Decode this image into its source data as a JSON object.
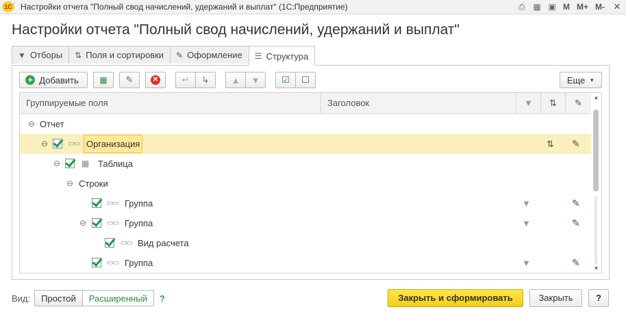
{
  "window": {
    "logo_text": "1С",
    "title": "Настройки отчета \"Полный свод начислений, удержаний и выплат\"  (1С:Предприятие)",
    "memory_buttons": [
      "M",
      "M+",
      "M-"
    ],
    "icons": [
      "print-icon",
      "calculator-icon",
      "calendar-icon"
    ]
  },
  "heading": "Настройки отчета \"Полный свод начислений, удержаний и выплат\"",
  "tabs": [
    {
      "label": "Отборы",
      "icon": "filter-icon",
      "active": false
    },
    {
      "label": "Поля и сортировки",
      "icon": "fields-sort-icon",
      "active": false
    },
    {
      "label": "Оформление",
      "icon": "brush-icon",
      "active": false
    },
    {
      "label": "Структура",
      "icon": "structure-icon",
      "active": true
    }
  ],
  "toolbar": {
    "add_label": "Добавить",
    "more_label": "Еще"
  },
  "grid": {
    "columns": [
      "Группируемые поля",
      "Заголовок"
    ],
    "rows": [
      {
        "label": "Отчет",
        "toggle": "minus",
        "checkbox": false,
        "field_icon": false,
        "filter": false,
        "sort": false,
        "brush": false,
        "selected": false
      },
      {
        "label": "Организация",
        "toggle": "minus",
        "checkbox": true,
        "field_icon": true,
        "filter": false,
        "sort": true,
        "brush": true,
        "selected": true
      },
      {
        "label": "Таблица",
        "toggle": "minus",
        "checkbox": true,
        "field_icon": "table",
        "filter": false,
        "sort": false,
        "brush": false,
        "selected": false
      },
      {
        "label": "Строки",
        "toggle": "minus",
        "checkbox": false,
        "field_icon": false,
        "filter": false,
        "sort": false,
        "brush": false,
        "selected": false
      },
      {
        "label": "Группа",
        "toggle": "",
        "checkbox": true,
        "field_icon": true,
        "filter": true,
        "sort": false,
        "brush": true,
        "selected": false
      },
      {
        "label": "Группа",
        "toggle": "minus",
        "checkbox": true,
        "field_icon": true,
        "filter": true,
        "sort": false,
        "brush": true,
        "selected": false
      },
      {
        "label": "Вид расчета",
        "toggle": "",
        "checkbox": true,
        "field_icon": true,
        "filter": false,
        "sort": false,
        "brush": false,
        "selected": false
      },
      {
        "label": "Группа",
        "toggle": "",
        "checkbox": true,
        "field_icon": true,
        "filter": true,
        "sort": false,
        "brush": true,
        "selected": false
      }
    ]
  },
  "bottom": {
    "view_label": "Вид:",
    "simple_label": "Простой",
    "extended_label": "Расширенный",
    "help": "?",
    "primary_button": "Закрыть и сформировать",
    "close_button": "Закрыть",
    "question_button": "?"
  },
  "colors": {
    "primary": "#f4cf18",
    "selected_row": "#fbf0bd",
    "check": "#1b9a48"
  }
}
